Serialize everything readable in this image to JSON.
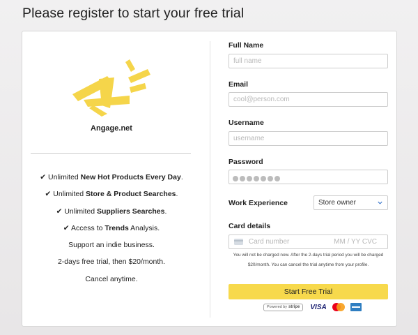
{
  "page": {
    "title": "Please register to start your free trial"
  },
  "left": {
    "brand": "Angage.net",
    "features": [
      {
        "check": "✔",
        "pre": " Unlimited ",
        "bold": "New Hot Products Every Day",
        "post": "."
      },
      {
        "check": "✔",
        "pre": " Unlimited ",
        "bold": "Store & Product Searches",
        "post": "."
      },
      {
        "check": "✔",
        "pre": " Unlimited ",
        "bold": "Suppliers Searches",
        "post": "."
      },
      {
        "check": "✔",
        "pre": " Access to ",
        "bold": "Trends",
        "post": " Analysis."
      },
      {
        "check": "",
        "pre": "Support an indie business.",
        "bold": "",
        "post": ""
      },
      {
        "check": "",
        "pre": "2-days free trial, then $20/month.",
        "bold": "",
        "post": ""
      },
      {
        "check": "",
        "pre": "Cancel anytime.",
        "bold": "",
        "post": ""
      }
    ]
  },
  "form": {
    "full_name": {
      "label": "Full Name",
      "placeholder": "full name"
    },
    "email": {
      "label": "Email",
      "placeholder": "cool@person.com"
    },
    "username": {
      "label": "Username",
      "placeholder": "username"
    },
    "password": {
      "label": "Password",
      "masked_length": 7
    },
    "work_experience": {
      "label": "Work Experience",
      "selected": "Store owner"
    },
    "card": {
      "label": "Card details",
      "number_placeholder": "Card number",
      "expiry_cvc_placeholder": "MM / YY  CVC"
    },
    "note_line1": "You will not be charged now. After the 2-days trial period you will be charged",
    "note_line2": "$20/month. You can cancel the trial anytime from your profile.",
    "submit": "Start Free Trial",
    "powered_by": "Powered by",
    "stripe": "stripe",
    "visa": "VISA"
  },
  "colors": {
    "accent": "#f7d94c",
    "logo": "#f5d54a"
  },
  "icons": {
    "logo": "megaphone-logo-icon",
    "select": "chevron-down-icon",
    "card": "credit-card-icon"
  }
}
